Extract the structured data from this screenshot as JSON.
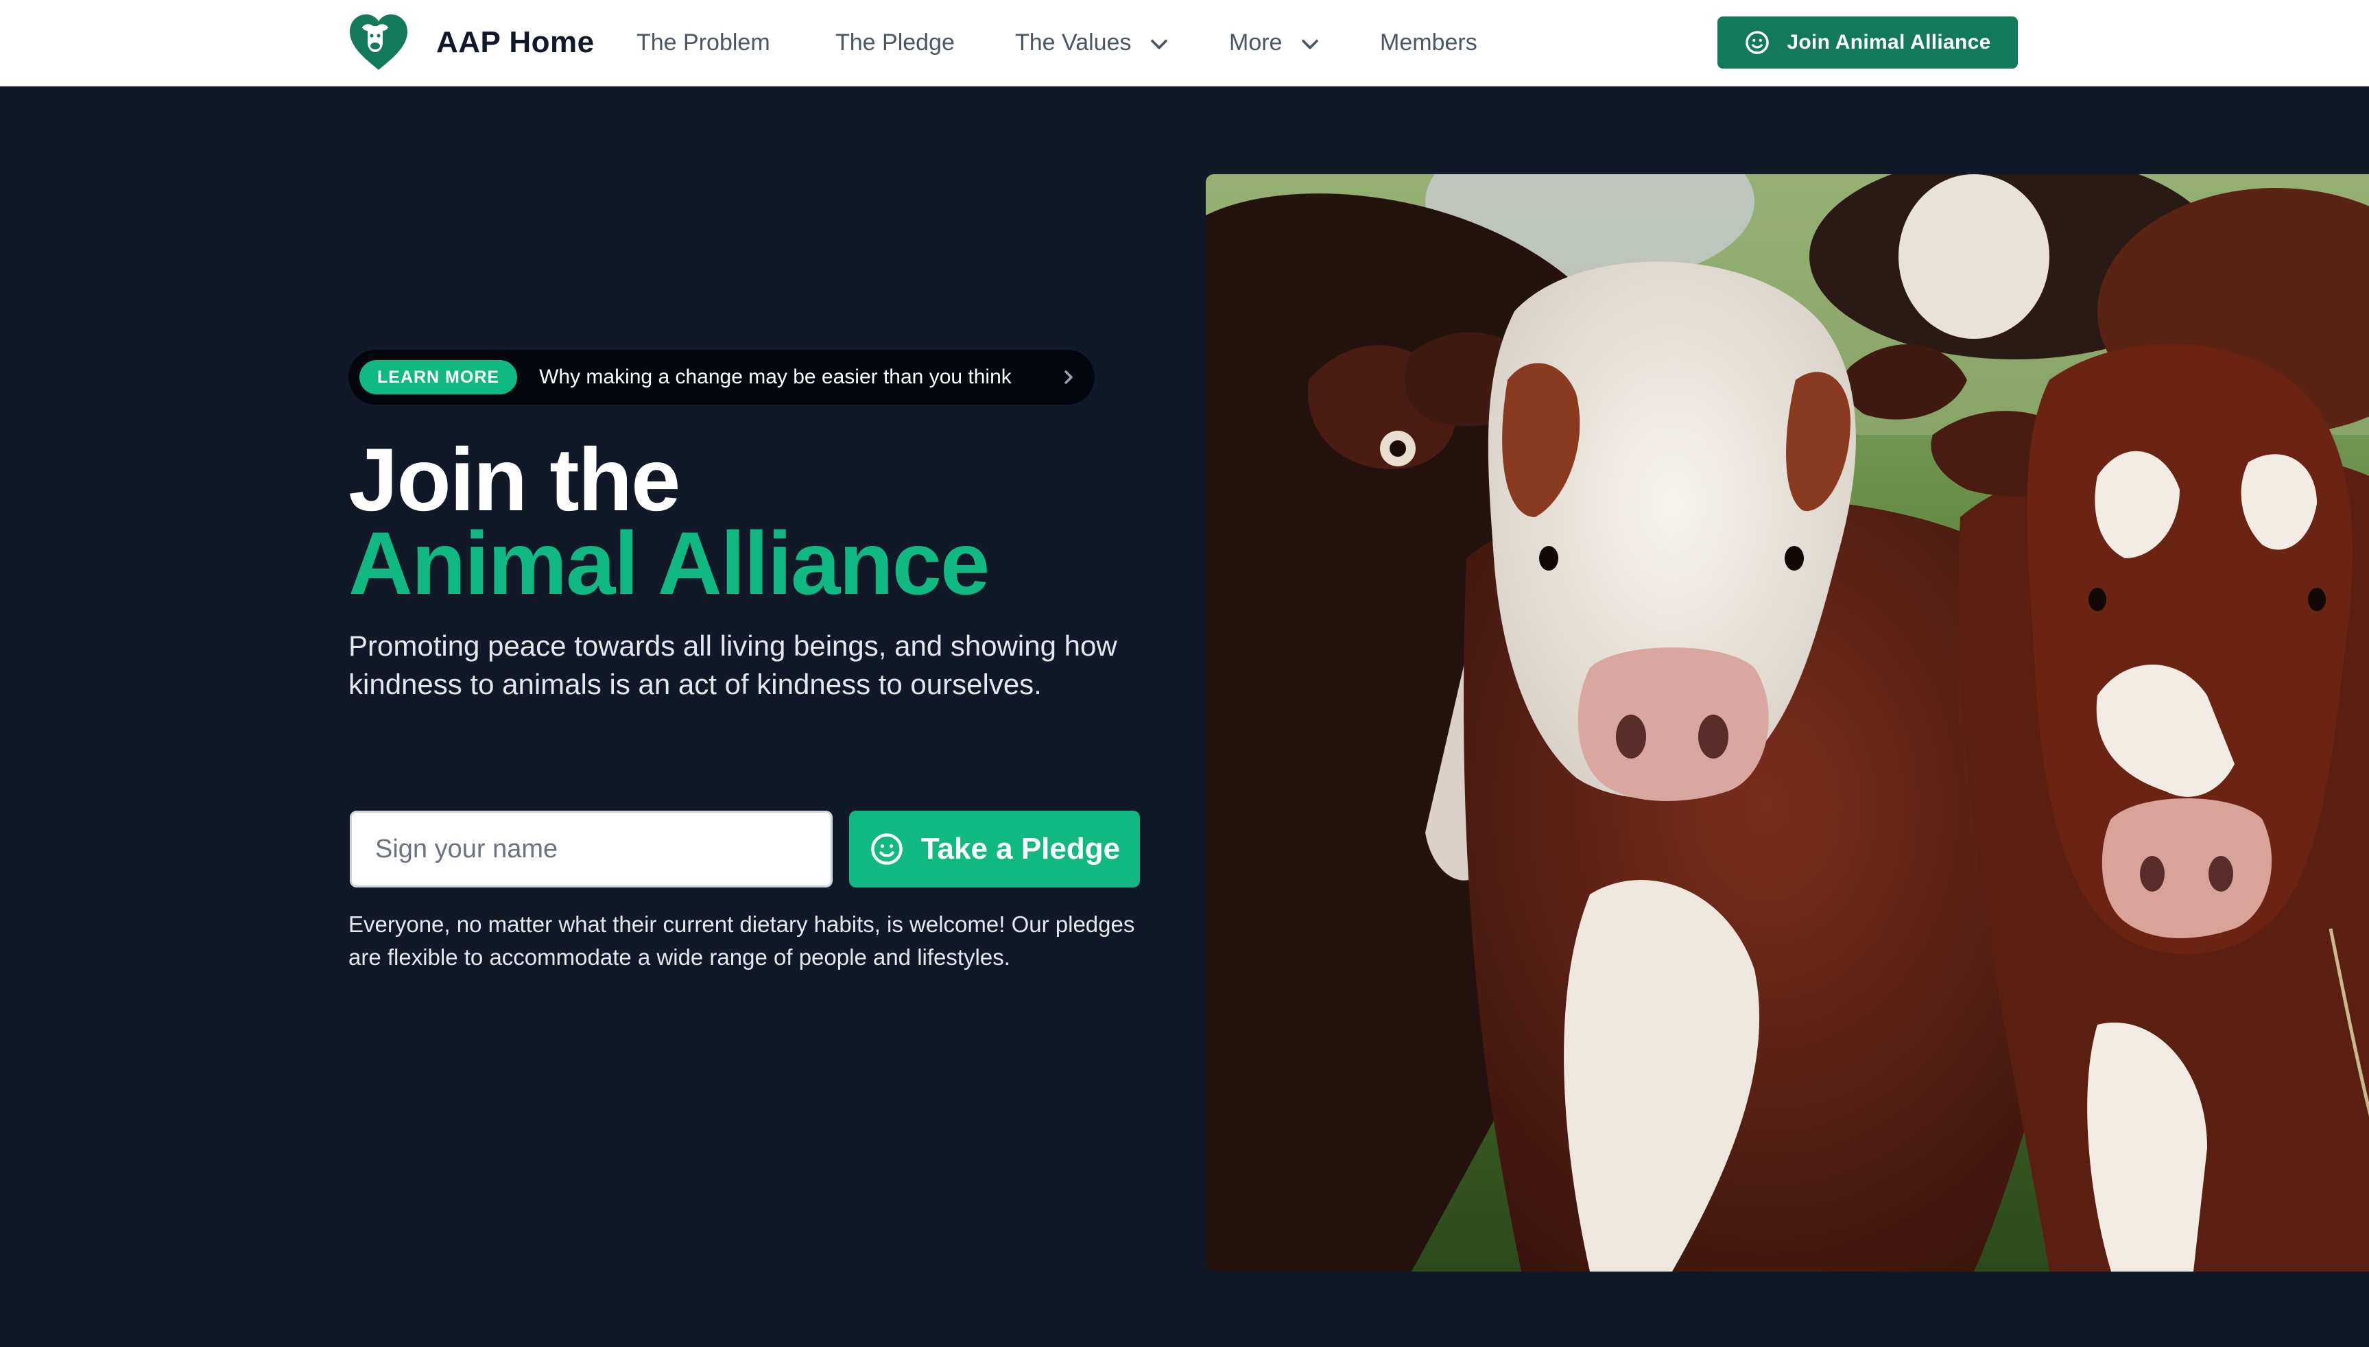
{
  "header": {
    "brand": "AAP Home",
    "nav": {
      "problem": "The Problem",
      "pledge": "The Pledge",
      "values": "The Values",
      "more": "More",
      "members": "Members"
    },
    "cta_label": "Join Animal Alliance"
  },
  "hero": {
    "pill": {
      "badge": "LEARN MORE",
      "text": "Why making a change may be easier than you think"
    },
    "headline_line1": "Join the",
    "headline_line2": "Animal Alliance",
    "subtitle": "Promoting peace towards all living beings, and showing how kindness to animals is an act of kindness to ourselves.",
    "name_placeholder": "Sign your name",
    "pledge_button": "Take a Pledge",
    "note": "Everyone, no matter what their current dietary habits, is welcome! Our pledges are flexible to accommodate a wide range of people and lifestyles."
  },
  "colors": {
    "page_background": "#111827",
    "accent_green": "#10b981",
    "header_cta_green": "#127a5a"
  },
  "icons": {
    "logo": "heart-with-cow-icon",
    "nav_dropdown": "chevron-down-icon",
    "cta": "smile-icon",
    "pill_arrow": "chevron-right-icon"
  },
  "image": {
    "subject": "herd of brown-and-white cows on green grass"
  }
}
